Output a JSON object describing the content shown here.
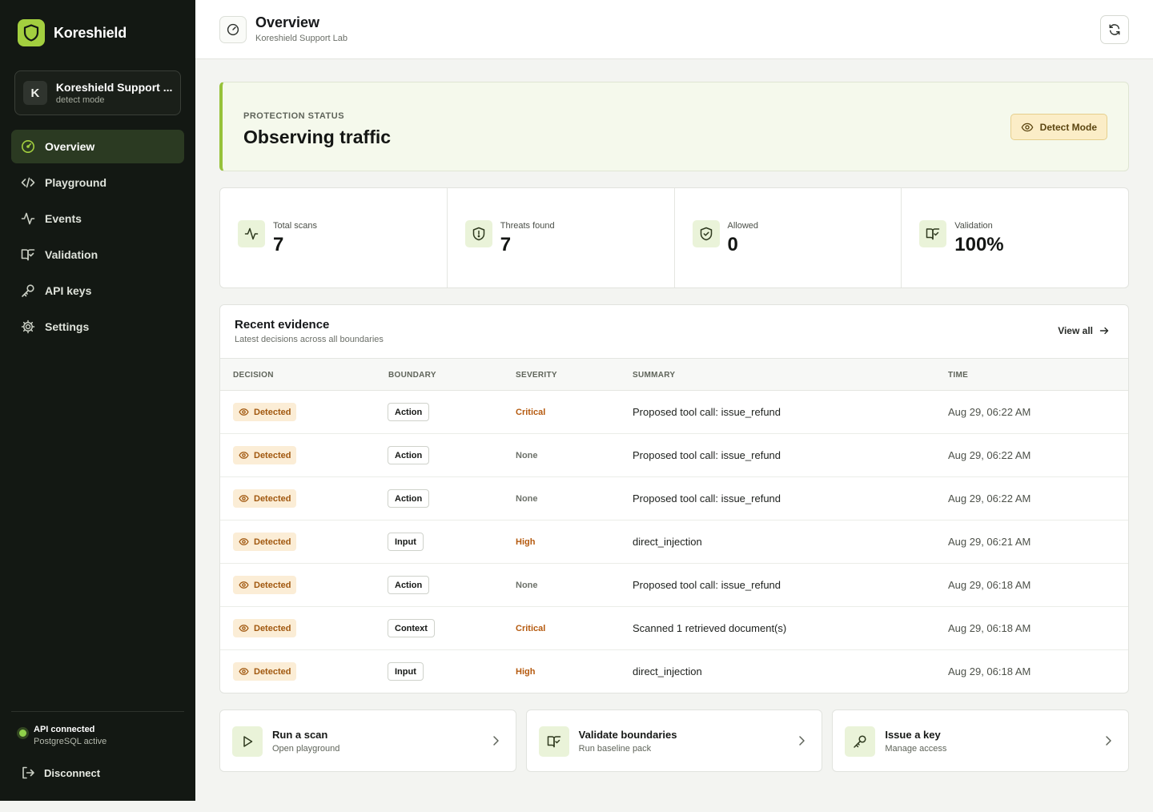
{
  "brand": {
    "name": "Koreshield"
  },
  "workspace": {
    "initial": "K",
    "name": "Koreshield Support ...",
    "mode": "detect mode"
  },
  "nav": {
    "items": [
      {
        "label": "Overview",
        "icon": "gauge-icon",
        "active": true
      },
      {
        "label": "Playground",
        "icon": "code-icon"
      },
      {
        "label": "Events",
        "icon": "activity-icon"
      },
      {
        "label": "Validation",
        "icon": "book-check-icon"
      },
      {
        "label": "API keys",
        "icon": "key-icon"
      },
      {
        "label": "Settings",
        "icon": "gear-icon"
      }
    ]
  },
  "api_status": {
    "title": "API connected",
    "subtitle": "PostgreSQL active",
    "color": "#8fd14a"
  },
  "disconnect_label": "Disconnect",
  "header": {
    "title": "Overview",
    "subtitle": "Koreshield Support Lab"
  },
  "protection": {
    "label": "PROTECTION STATUS",
    "title": "Observing traffic",
    "mode_badge": "Detect Mode",
    "accent": "#97c23a"
  },
  "stats": [
    {
      "label": "Total scans",
      "value": "7",
      "icon": "activity-icon"
    },
    {
      "label": "Threats found",
      "value": "7",
      "icon": "shield-alert-icon"
    },
    {
      "label": "Allowed",
      "value": "0",
      "icon": "shield-check-icon"
    },
    {
      "label": "Validation",
      "value": "100%",
      "icon": "book-check-icon"
    }
  ],
  "evidence": {
    "title": "Recent evidence",
    "subtitle": "Latest decisions across all boundaries",
    "view_all": "View all",
    "columns": {
      "decision": "DECISION",
      "boundary": "BOUNDARY",
      "severity": "SEVERITY",
      "summary": "SUMMARY",
      "time": "TIME"
    },
    "rows": [
      {
        "decision": "Detected",
        "boundary": "Action",
        "severity": "Critical",
        "summary": "Proposed tool call: issue_refund",
        "time": "Aug 29, 06:22 AM"
      },
      {
        "decision": "Detected",
        "boundary": "Action",
        "severity": "None",
        "summary": "Proposed tool call: issue_refund",
        "time": "Aug 29, 06:22 AM"
      },
      {
        "decision": "Detected",
        "boundary": "Action",
        "severity": "None",
        "summary": "Proposed tool call: issue_refund",
        "time": "Aug 29, 06:22 AM"
      },
      {
        "decision": "Detected",
        "boundary": "Input",
        "severity": "High",
        "summary": "direct_injection",
        "time": "Aug 29, 06:21 AM"
      },
      {
        "decision": "Detected",
        "boundary": "Action",
        "severity": "None",
        "summary": "Proposed tool call: issue_refund",
        "time": "Aug 29, 06:18 AM"
      },
      {
        "decision": "Detected",
        "boundary": "Context",
        "severity": "Critical",
        "summary": "Scanned 1 retrieved document(s)",
        "time": "Aug 29, 06:18 AM"
      },
      {
        "decision": "Detected",
        "boundary": "Input",
        "severity": "High",
        "summary": "direct_injection",
        "time": "Aug 29, 06:18 AM"
      }
    ]
  },
  "actions": [
    {
      "title": "Run a scan",
      "subtitle": "Open playground",
      "icon": "play-icon"
    },
    {
      "title": "Validate boundaries",
      "subtitle": "Run baseline pack",
      "icon": "book-check-icon"
    },
    {
      "title": "Issue a key",
      "subtitle": "Manage access",
      "icon": "key-icon"
    }
  ]
}
